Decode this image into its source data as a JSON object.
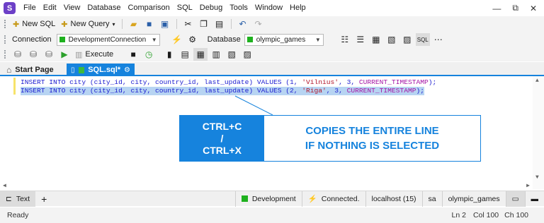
{
  "menu": [
    "File",
    "Edit",
    "View",
    "Database",
    "Comparison",
    "SQL",
    "Debug",
    "Tools",
    "Window",
    "Help"
  ],
  "toolbar1": {
    "new_sql": "New SQL",
    "new_query": "New Query"
  },
  "toolbar2": {
    "connection_label": "Connection",
    "connection_value": "DevelopmentConnection",
    "database_label": "Database",
    "database_value": "olympic_games"
  },
  "toolbar3": {
    "execute_label": "Execute"
  },
  "tabs": [
    {
      "label": "Start Page"
    },
    {
      "label": "SQL.sql*"
    }
  ],
  "editor": {
    "line1": {
      "a": "INSERT INTO city (city_id, city, country_id, last_update) VALUES (1, ",
      "s": "'Vilnius'",
      "b": ", 3, ",
      "f": "CURRENT_TIMESTAMP",
      "c": ");"
    },
    "line2": {
      "a": "INSERT INTO city (city_id, city, country_id, last_update) VALUES (2, ",
      "s": "'Riga'",
      "b": ", 3, ",
      "f": "CURRENT_TIMESTAMP",
      "c": ");"
    }
  },
  "callout": {
    "key1": "CTRL+C",
    "slash": "/",
    "key2": "CTRL+X",
    "desc1": "COPIES THE ENTIRE LINE",
    "desc2": "IF NOTHING IS SELECTED"
  },
  "bottombar": {
    "text_tab": "Text",
    "add": "+",
    "env": "Development",
    "status": "Connected.",
    "host": "localhost (15)",
    "user": "sa",
    "database": "olympic_games"
  },
  "statusbar": {
    "ready": "Ready",
    "ln": "Ln 2",
    "col": "Col 100",
    "ch": "Ch 100"
  },
  "colors": {
    "accent": "#1683dd",
    "connected": "#1fb11f"
  }
}
